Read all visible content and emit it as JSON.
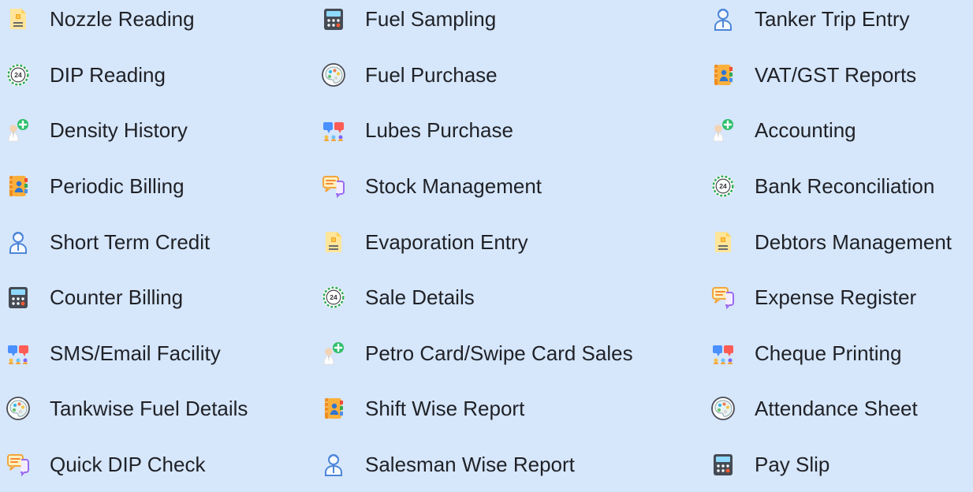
{
  "features": {
    "columns": [
      [
        {
          "label": "Nozzle Reading",
          "icon": "document-icon"
        },
        {
          "label": "DIP Reading",
          "icon": "clock-24-icon"
        },
        {
          "label": "Density History",
          "icon": "support-agent-icon"
        },
        {
          "label": "Periodic Billing",
          "icon": "contacts-book-icon"
        },
        {
          "label": "Short Term Credit",
          "icon": "user-icon"
        },
        {
          "label": "Counter Billing",
          "icon": "calculator-icon"
        },
        {
          "label": "SMS/Email Facility",
          "icon": "team-chat-icon"
        },
        {
          "label": "Tankwise Fuel Details",
          "icon": "palette-icon"
        },
        {
          "label": "Quick DIP Check",
          "icon": "chat-bubbles-icon"
        }
      ],
      [
        {
          "label": "Fuel Sampling",
          "icon": "calculator-icon"
        },
        {
          "label": "Fuel Purchase",
          "icon": "palette-icon"
        },
        {
          "label": "Lubes Purchase",
          "icon": "team-chat-icon"
        },
        {
          "label": "Stock Management",
          "icon": "chat-bubbles-icon"
        },
        {
          "label": "Evaporation Entry",
          "icon": "document-icon"
        },
        {
          "label": "Sale Details",
          "icon": "clock-24-icon"
        },
        {
          "label": "Petro Card/Swipe Card Sales",
          "icon": "support-agent-icon"
        },
        {
          "label": "Shift Wise Report",
          "icon": "contacts-book-icon"
        },
        {
          "label": "Salesman Wise Report",
          "icon": "user-icon"
        }
      ],
      [
        {
          "label": "Tanker Trip Entry",
          "icon": "user-icon"
        },
        {
          "label": "VAT/GST Reports",
          "icon": "contacts-book-icon"
        },
        {
          "label": "Accounting",
          "icon": "support-agent-icon"
        },
        {
          "label": "Bank Reconciliation",
          "icon": "clock-24-icon"
        },
        {
          "label": "Debtors Management",
          "icon": "document-icon"
        },
        {
          "label": "Expense Register",
          "icon": "chat-bubbles-icon"
        },
        {
          "label": "Cheque Printing",
          "icon": "team-chat-icon"
        },
        {
          "label": "Attendance Sheet",
          "icon": "palette-icon"
        },
        {
          "label": "Pay Slip",
          "icon": "calculator-icon"
        }
      ]
    ]
  },
  "clock_text": "24"
}
